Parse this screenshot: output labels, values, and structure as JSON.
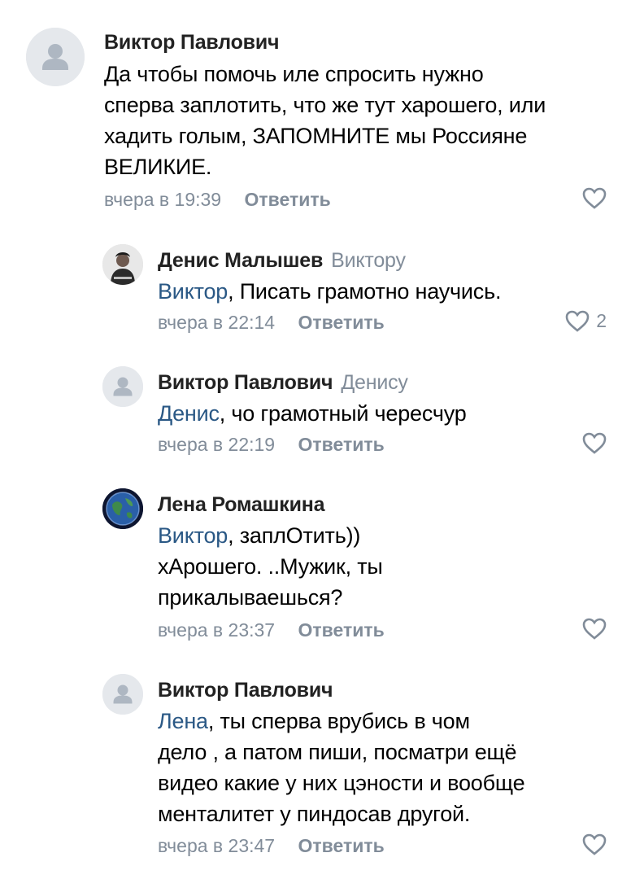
{
  "comments": [
    {
      "author": "Виктор Павлович",
      "to": "",
      "mention": "",
      "text_lines": [
        "Да чтобы помочь иле спросить нужно",
        "сперва заплотить, что же тут харошего, или",
        "хадить голым, ЗАПОМНИТЕ мы Россияне",
        "ВЕЛИКИЕ."
      ],
      "time": "вчера в 19:39",
      "reply_label": "Ответить",
      "likes": "",
      "avatar_icon": "user-placeholder-icon"
    },
    {
      "author": "Денис Малышев",
      "to": "Виктору",
      "mention": "Виктор",
      "text_lines": [
        ", Писать грамотно научись."
      ],
      "time": "вчера в 22:14",
      "reply_label": "Ответить",
      "likes": "2",
      "avatar_icon": "photo-avatar-icon"
    },
    {
      "author": "Виктор Павлович",
      "to": "Денису",
      "mention": "Денис",
      "text_lines": [
        ", чо грамотный чересчур"
      ],
      "time": "вчера в 22:19",
      "reply_label": "Ответить",
      "likes": "",
      "avatar_icon": "user-placeholder-icon"
    },
    {
      "author": "Лена Ромашкина",
      "to": "",
      "mention": "Виктор",
      "text_lines": [
        ", заплОтить))",
        "хАрошего. ..Мужик, ты",
        "прикалываешься?"
      ],
      "time": "вчера в 23:37",
      "reply_label": "Ответить",
      "likes": "",
      "avatar_icon": "earth-avatar-icon"
    },
    {
      "author": "Виктор Павлович",
      "to": "",
      "mention": "Лена",
      "text_lines": [
        ", ты сперва врубись  в чом",
        "дело , а патом пиши, посматри ещё",
        "видео какие у них цэности и вообще",
        "менталитет у пиндосав другой."
      ],
      "time": "вчера в 23:47",
      "reply_label": "Ответить",
      "likes": "",
      "avatar_icon": "user-placeholder-icon"
    }
  ],
  "colors": {
    "link": "#2a5885",
    "secondary": "#818c99",
    "avatar_bg": "#e5e8ec"
  }
}
